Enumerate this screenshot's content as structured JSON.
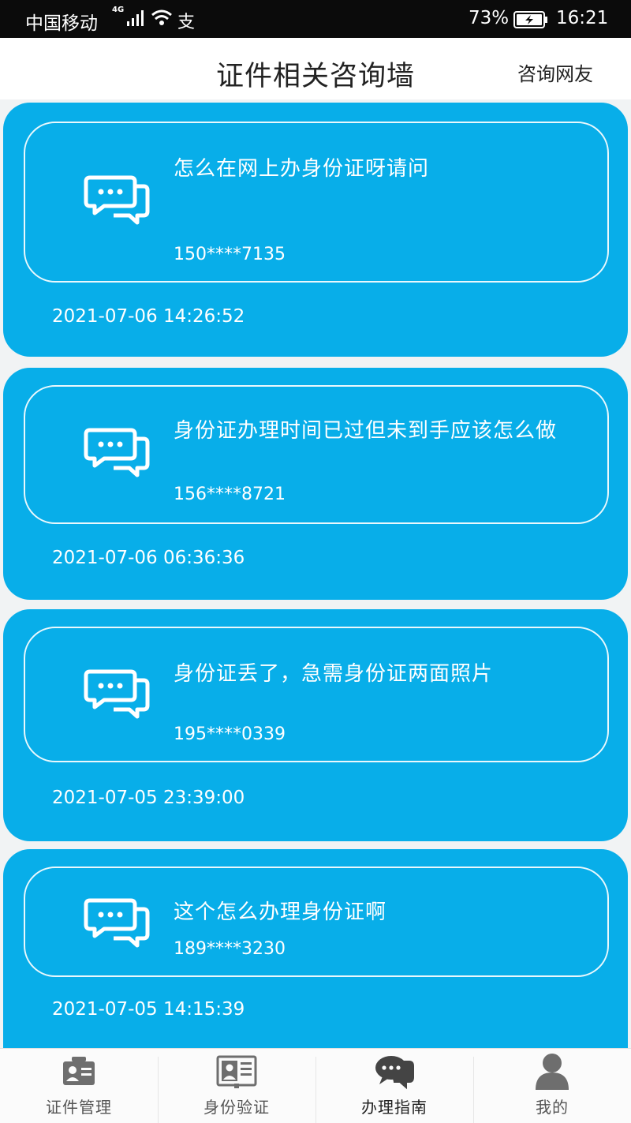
{
  "status_bar": {
    "carrier": "中国移动",
    "network": "4G",
    "app_indicator": "支",
    "battery_percent": "73%",
    "time": "16:21"
  },
  "header": {
    "title": "证件相关咨询墙",
    "action_label": "咨询网友"
  },
  "posts": [
    {
      "question": "怎么在网上办身份证呀请问",
      "phone": "150****7135",
      "datetime": "2021-07-06 14:26:52"
    },
    {
      "question": "身份证办理时间已过但未到手应该怎么做",
      "phone": "156****8721",
      "datetime": "2021-07-06 06:36:36"
    },
    {
      "question": "身份证丢了，急需身份证两面照片",
      "phone": "195****0339",
      "datetime": "2021-07-05 23:39:00"
    },
    {
      "question": "这个怎么办理身份证啊",
      "phone": "189****3230",
      "datetime": "2021-07-05 14:15:39"
    }
  ],
  "tabbar": {
    "items": [
      {
        "label": "证件管理",
        "icon": "id-card-icon"
      },
      {
        "label": "身份验证",
        "icon": "identity-verify-icon"
      },
      {
        "label": "办理指南",
        "icon": "chat-bubbles-icon"
      },
      {
        "label": "我的",
        "icon": "user-icon"
      }
    ],
    "active_index": 2
  },
  "colors": {
    "card_background": "#08aee9",
    "page_background": "#f1f3f4",
    "status_bar": "#0b0b0b",
    "tab_icon": "#6e6e6e",
    "tab_icon_active": "#444444"
  }
}
